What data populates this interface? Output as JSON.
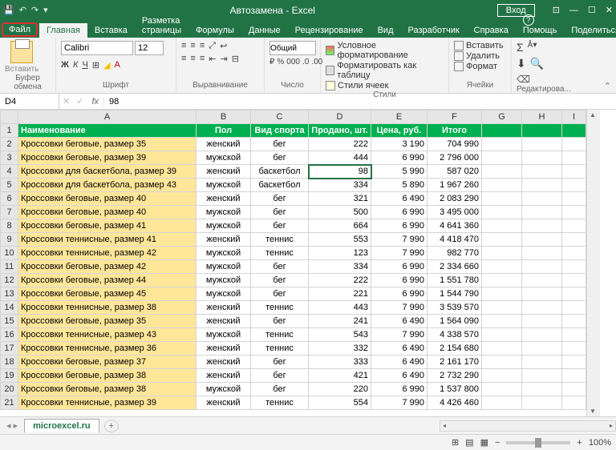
{
  "title": "Автозамена - Excel",
  "signin": "Вход",
  "tabs": {
    "file": "Файл",
    "home": "Главная",
    "insert": "Вставка",
    "layout": "Разметка страницы",
    "formulas": "Формулы",
    "data": "Данные",
    "review": "Рецензирование",
    "view": "Вид",
    "developer": "Разработчик",
    "help": "Справка",
    "tell": "Помощь",
    "share": "Поделиться"
  },
  "ribbon": {
    "paste": "Вставить",
    "font_name": "Calibri",
    "font_size": "12",
    "number_format": "Общий",
    "cond_format": "Условное форматирование",
    "as_table": "Форматировать как таблицу",
    "cell_styles": "Стили ячеек",
    "ins": "Вставить",
    "del": "Удалить",
    "fmt": "Формат",
    "groups": {
      "clipboard": "Буфер обмена",
      "font": "Шрифт",
      "align": "Выравнивание",
      "number": "Число",
      "styles": "Стили",
      "cells": "Ячейки",
      "editing": "Редактирова..."
    }
  },
  "name_box": "D4",
  "formula": "98",
  "cols": [
    "A",
    "B",
    "C",
    "D",
    "E",
    "F",
    "G",
    "H",
    "I"
  ],
  "header_row": [
    "Наименование",
    "Пол",
    "Вид спорта",
    "Продано, шт.",
    "Цена, руб.",
    "Итого"
  ],
  "rows": [
    [
      "Кроссовки беговые, размер 35",
      "женский",
      "бег",
      "222",
      "3 190",
      "704 990"
    ],
    [
      "Кроссовки беговые, размер 39",
      "мужской",
      "бег",
      "444",
      "6 990",
      "2 796 000"
    ],
    [
      "Кроссовки для баскетбола, размер 39",
      "женский",
      "баскетбол",
      "98",
      "5 990",
      "587 020"
    ],
    [
      "Кроссовки для баскетбола, размер 43",
      "мужской",
      "баскетбол",
      "334",
      "5 890",
      "1 967 260"
    ],
    [
      "Кроссовки беговые, размер 40",
      "женский",
      "бег",
      "321",
      "6 490",
      "2 083 290"
    ],
    [
      "Кроссовки беговые, размер 40",
      "мужской",
      "бег",
      "500",
      "6 990",
      "3 495 000"
    ],
    [
      "Кроссовки беговые, размер 41",
      "мужской",
      "бег",
      "664",
      "6 990",
      "4 641 360"
    ],
    [
      "Кроссовки теннисные, размер 41",
      "женский",
      "теннис",
      "553",
      "7 990",
      "4 418 470"
    ],
    [
      "Кроссовки теннисные, размер 42",
      "мужской",
      "теннис",
      "123",
      "7 990",
      "982 770"
    ],
    [
      "Кроссовки беговые, размер 42",
      "мужской",
      "бег",
      "334",
      "6 990",
      "2 334 660"
    ],
    [
      "Кроссовки беговые, размер 44",
      "мужской",
      "бег",
      "222",
      "6 990",
      "1 551 780"
    ],
    [
      "Кроссовки беговые, размер 45",
      "мужской",
      "бег",
      "221",
      "6 990",
      "1 544 790"
    ],
    [
      "Кроссовки теннисные, размер 38",
      "женский",
      "теннис",
      "443",
      "7 990",
      "3 539 570"
    ],
    [
      "Кроссовки беговые, размер 35",
      "женский",
      "бег",
      "241",
      "6 490",
      "1 564 090"
    ],
    [
      "Кроссовки теннисные, размер 43",
      "мужской",
      "теннис",
      "543",
      "7 990",
      "4 338 570"
    ],
    [
      "Кроссовки теннисные, размер 36",
      "женский",
      "теннис",
      "332",
      "6 490",
      "2 154 680"
    ],
    [
      "Кроссовки беговые, размер 37",
      "женский",
      "бег",
      "333",
      "6 490",
      "2 161 170"
    ],
    [
      "Кроссовки беговые, размер 38",
      "женский",
      "бег",
      "421",
      "6 490",
      "2 732 290"
    ],
    [
      "Кроссовки беговые, размер 38",
      "мужской",
      "бег",
      "220",
      "6 990",
      "1 537 800"
    ],
    [
      "Кроссовки теннисные, размер 39",
      "женский",
      "теннис",
      "554",
      "7 990",
      "4 426 460"
    ]
  ],
  "sheet_tab": "microexcel.ru",
  "zoom": "100%"
}
